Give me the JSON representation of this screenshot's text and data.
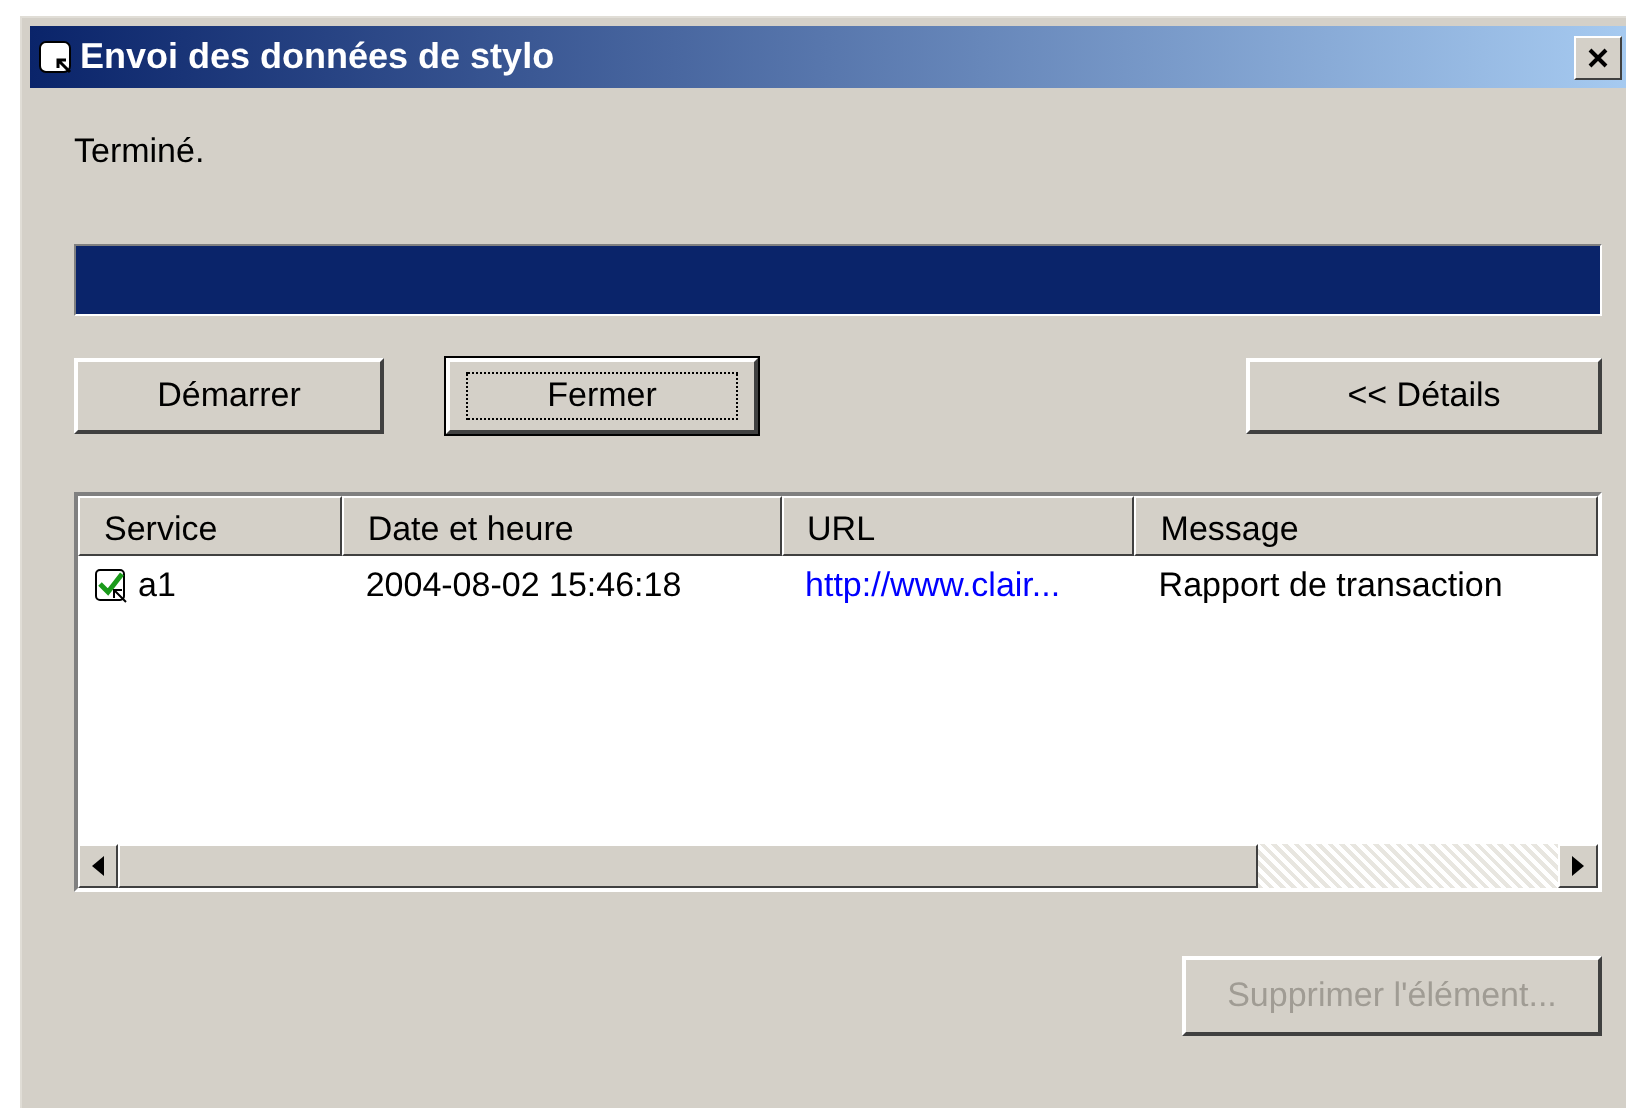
{
  "window": {
    "title": "Envoi des données de stylo"
  },
  "status_text": "Terminé.",
  "progress": {
    "level": 1
  },
  "buttons": [
    {
      "label": "Démarrer",
      "focused": false
    },
    {
      "label": "Fermer",
      "focused": true
    },
    {
      "label": "<< Détails",
      "focused": false
    }
  ],
  "table": {
    "columns": [
      "Service",
      "Date et heure",
      "URL",
      "Message"
    ],
    "rows": [
      {
        "service": "a1",
        "date": "2004-08-02 15:46:18",
        "url": "http://www.clair...",
        "message": "Rapport de transaction"
      }
    ]
  },
  "delete_button": {
    "label": "Supprimer l'élément...",
    "disabled": true
  }
}
